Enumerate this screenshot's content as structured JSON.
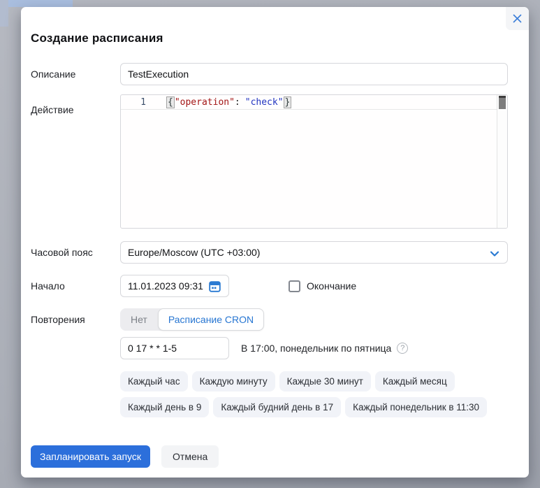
{
  "modal": {
    "title": "Создание расписания",
    "description": {
      "label": "Описание",
      "value": "TestExecution"
    },
    "action": {
      "label": "Действие",
      "line_number": "1",
      "code": {
        "open_brace": "{",
        "key": "\"operation\"",
        "colon": ":",
        "value": "\"check\"",
        "close_brace": "}"
      }
    },
    "timezone": {
      "label": "Часовой пояс",
      "value": "Europe/Moscow (UTC +03:00)"
    },
    "start": {
      "label": "Начало",
      "value": "11.01.2023 09:31",
      "end_label": "Окончание",
      "end_checked": false
    },
    "repeat": {
      "label": "Повторения",
      "option_none": "Нет",
      "option_cron": "Расписание CRON",
      "active_option": "Расписание CRON",
      "cron_value": "0 17 * * 1-5",
      "cron_hint": "В 17:00, понедельник по пятница",
      "help_glyph": "?"
    },
    "presets": {
      "row1": [
        "Каждый час",
        "Каждую минуту",
        "Каждые 30 минут",
        "Каждый месяц"
      ],
      "row2": [
        "Каждый день в 9",
        "Каждый будний день в 17",
        "Каждый понедельник в 11:30"
      ]
    },
    "footer": {
      "submit": "Запланировать запуск",
      "cancel": "Отмена"
    },
    "colors": {
      "accent_blue": "#2c6fdb",
      "link_blue": "#2776d2",
      "code_key_red": "#a31515",
      "code_value_blue": "#2234c0"
    }
  }
}
